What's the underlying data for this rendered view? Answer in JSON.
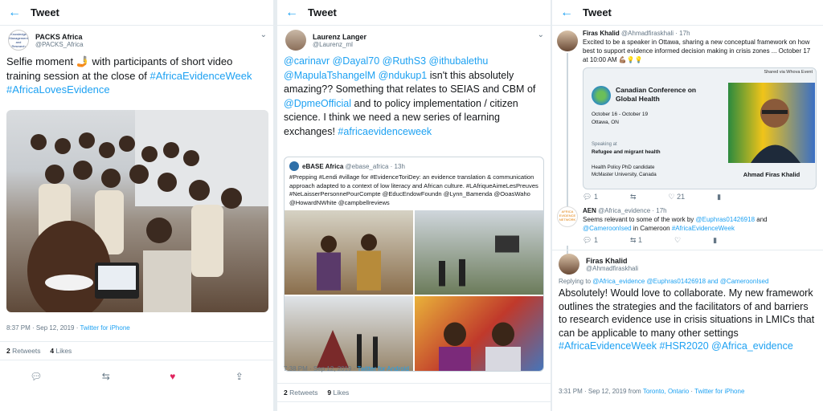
{
  "header_title": "Tweet",
  "col1": {
    "author_name": "PACKS Africa",
    "author_handle": "@PACKS_Africa",
    "avatar_text": "Knowledge Management and Research",
    "text_plain": "Selfie moment 🤳 with participants of short video training session at the close of",
    "hashtags": "#AfricaEvidenceWeek #AfricaLovesEvidence",
    "timestamp": "8:37 PM · Sep 12, 2019 · ",
    "source": "Twitter for iPhone",
    "retweets_count": "2",
    "retweets_label": "Retweets",
    "likes_count": "4",
    "likes_label": "Likes"
  },
  "col2": {
    "author_name": "Laurenz Langer",
    "author_handle": "@Laurenz_ml",
    "text_line1_mentions": "@carinavr @Dayal70 @RuthS3 @ithubalethu",
    "text_line2_mentions": "@MapulaTshangelM @ndukup1",
    "text_body1": " isn't this absolutely amazing?? Something that relates to SEIAS and CBM of ",
    "text_mention_dpme": "@DpmeOfficial",
    "text_body2": " and to policy implementation / citizen science. I think we need a new series of learning exchanges! ",
    "text_hashtag": "#africaevidenceweek",
    "quote_name": "eBASE Africa",
    "quote_handle": "@ebase_africa · 13h",
    "quote_text": "#Prepping #Lendi #village for #EvidenceToriDey: an evidence translation & communication approach adapted to a context of low literacy and African culture. #LAfriqueAimeLesPreuves #NeLaisserPersonnePourCompte @EducEndowFoundn @Lynn_Bamenda @OoasWaho @HowardNWhite @campbellreviews",
    "timestamp": "7:38 PM · Sep 12, 2019 · ",
    "source": "Twitter for Android",
    "retweets_count": "2",
    "retweets_label": "Retweets",
    "likes_count": "9",
    "likes_label": "Likes"
  },
  "col3": {
    "t1_name": "Firas Khalid",
    "t1_handle": "@Ahmadfiraskhali · 17h",
    "t1_text": "Excited to be a speaker in Ottawa, sharing a new conceptual framework on how best to support evidence informed decision making in crisis zones ... October 17 at 10:00 AM 💪🏽💡💡",
    "card_shared": "Shared via Whova Event",
    "card_conf_title": "Canadian Conference on Global Health",
    "card_dates": "October 16 - October 19",
    "card_place": "Ottawa, ON",
    "card_speaking_label": "Speaking at",
    "card_speaking_value": "Refugee and migrant health",
    "card_role1": "Health Policy PhD candidate",
    "card_role2": "McMaster University, Canada",
    "card_person_name": "Ahmad Firas Khalid",
    "t1_replies": "1",
    "t1_likes": "21",
    "t2_name": "AEN",
    "t2_handle": "@Africa_evidence · 17h",
    "t2_avatar_text": "AFRICA EVIDENCE NETWORK",
    "t2_text_plain": "Seems relevant to some of the work by ",
    "t2_mention1": "@Euphras01426918",
    "t2_and": " and ",
    "t2_mention2": "@CameroonIsed",
    "t2_in": " in Cameroon ",
    "t2_hashtag": "#AfricaEvidenceWeek",
    "t2_replies": "1",
    "t2_retweets": "1",
    "t3_name": "Firas Khalid",
    "t3_handle": "@Ahmadfiraskhali",
    "t3_replying": "Replying to ",
    "t3_replying_mentions": "@Africa_evidence @Euphras01426918 and @CameroonIsed",
    "t3_text": "Absolutely! Would love to collaborate. My new framework outlines the strategies and the facilitators of and barriers to research evidence use in crisis situations in LMICs that can be applicable to many other settings ",
    "t3_hashtags": "#AfricaEvidenceWeek #HSR2020 @Africa_evidence",
    "t3_timestamp": "3:31 PM · Sep 12, 2019 from ",
    "t3_location": "Toronto, Ontario",
    "t3_sep": " · ",
    "t3_source": "Twitter for iPhone"
  },
  "colors": {
    "accent": "#1da1f2",
    "muted": "#657786",
    "like_red": "#e0245e"
  }
}
